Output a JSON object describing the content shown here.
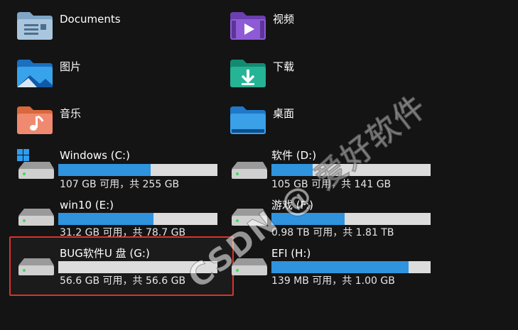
{
  "folders": [
    {
      "label": "Documents",
      "icon": "documents-folder-icon"
    },
    {
      "label": "视频",
      "icon": "videos-folder-icon"
    },
    {
      "label": "图片",
      "icon": "pictures-folder-icon"
    },
    {
      "label": "下载",
      "icon": "downloads-folder-icon"
    },
    {
      "label": "音乐",
      "icon": "music-folder-icon"
    },
    {
      "label": "桌面",
      "icon": "desktop-folder-icon"
    }
  ],
  "drives": [
    {
      "label": "Windows (C:)",
      "capacity": "107 GB 可用，共 255 GB",
      "used_fraction": 0.58,
      "icon": "windows-drive-icon"
    },
    {
      "label": "软件 (D:)",
      "capacity": "105 GB 可用，共 141 GB",
      "used_fraction": 0.26,
      "icon": "hard-drive-icon"
    },
    {
      "label": "win10 (E:)",
      "capacity": "31.2 GB 可用，共 78.7 GB",
      "used_fraction": 0.6,
      "icon": "hard-drive-icon"
    },
    {
      "label": "游戏 (F:)",
      "capacity": "0.98 TB 可用，共 1.81 TB",
      "used_fraction": 0.46,
      "icon": "hard-drive-icon"
    },
    {
      "label": "BUG软件U 盘 (G:)",
      "capacity": "56.6 GB 可用，共 56.6 GB",
      "used_fraction": 0.0,
      "icon": "usb-drive-icon"
    },
    {
      "label": "EFI (H:)",
      "capacity": "139 MB 可用，共 1.00 GB",
      "used_fraction": 0.86,
      "icon": "hard-drive-icon"
    }
  ],
  "watermark": "CSDN @ 爱好软件",
  "colors": {
    "bar_fill": "#2f93de",
    "bar_track": "#dcdcdc",
    "selection_border": "#d9332b"
  }
}
